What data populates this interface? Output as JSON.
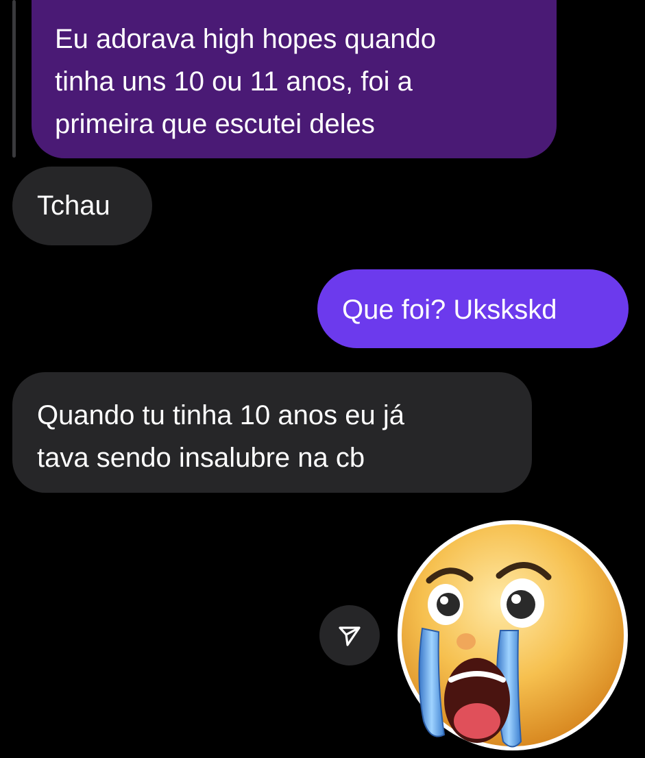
{
  "conversation": {
    "quoted_message": {
      "text": "Eu adorava high hopes quando tinha uns 10 ou 11 anos, foi a primeira que escutei deles",
      "lines": [
        "Eu adorava high hopes quando",
        "tinha uns 10 ou 11 anos, foi a",
        "primeira que escutei deles"
      ]
    },
    "messages": [
      {
        "side": "received",
        "lines": [
          "Tchau"
        ]
      },
      {
        "side": "sent",
        "lines": [
          "Que foi? Ukskskd"
        ]
      },
      {
        "side": "received",
        "lines": [
          "Quando tu tinha 10 anos eu já",
          "tava sendo insalubre na cb"
        ]
      }
    ],
    "sticker": {
      "icon": "loudly-crying-face-icon"
    },
    "share_button": {
      "icon": "send-icon"
    }
  },
  "colors": {
    "background": "#000000",
    "quoted_bubble": "#4a1a75",
    "received_bubble": "#262628",
    "sent_bubble": "#6c3aed",
    "text": "#ffffff"
  }
}
